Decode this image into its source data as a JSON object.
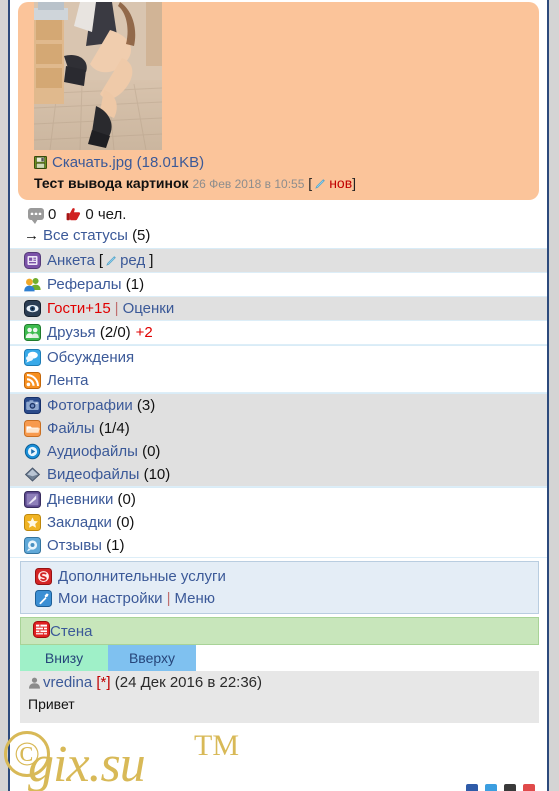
{
  "status_card": {
    "photo_alt": "status-photo",
    "file": {
      "icon": "floppy-disk-icon",
      "name": "Скачать.jpg",
      "size": "(18.01KB)"
    },
    "title": "Тест вывода картинок",
    "date": "26 Фев 2018 в 10:55",
    "edit_open": "[",
    "edit_label": "нов",
    "edit_close": "]"
  },
  "counters": {
    "comments_icon": "comment-bubble-icon",
    "comments": "0",
    "likes_icon": "thumbs-up-icon",
    "likes": "0 чел.",
    "all_statuses_arrow": "→",
    "all_statuses_label": "Все статусы",
    "all_statuses_count": "(5)"
  },
  "menu": {
    "group1": [
      {
        "icon": "profile-card-icon",
        "label": "Анкета",
        "open": "[",
        "action": "ред",
        "close": "]",
        "shaded": true
      },
      {
        "icon": "referrals-people-icon",
        "label": "Рефералы",
        "count": "(1)",
        "shaded": false
      },
      {
        "icon": "eye-icon",
        "label": "Гости",
        "plus": "+15",
        "sep": "|",
        "label2": "Оценки",
        "shaded": true
      },
      {
        "icon": "friends-icon",
        "label": "Друзья",
        "count": "(2/0)",
        "plus": "+2",
        "shaded": false
      }
    ],
    "group2": [
      {
        "icon": "discussions-icon",
        "label": "Обсуждения"
      },
      {
        "icon": "rss-feed-icon",
        "label": "Лента"
      }
    ],
    "group3": [
      {
        "icon": "photos-camera-icon",
        "label": "Фотографии",
        "count": "(3)"
      },
      {
        "icon": "files-folder-icon",
        "label": "Файлы",
        "count": "(1/4)"
      },
      {
        "icon": "audio-play-icon",
        "label": "Аудиофайлы",
        "count": "(0)"
      },
      {
        "icon": "video-diamond-icon",
        "label": "Видеофайлы",
        "count": "(10)"
      }
    ],
    "group4": [
      {
        "icon": "diary-icon",
        "label": "Дневники",
        "count": "(0)"
      },
      {
        "icon": "bookmark-star-icon",
        "label": "Закладки",
        "count": "(0)"
      },
      {
        "icon": "reviews-icon",
        "label": "Отзывы",
        "count": "(1)"
      }
    ]
  },
  "services": {
    "extra_icon": "extra-services-icon",
    "extra_label": "Дополнительные услуги",
    "settings_icon": "wrench-settings-icon",
    "settings_label": "Мои настройки",
    "separator": "|",
    "menu_label": "Меню"
  },
  "wall": {
    "icon": "wall-brick-icon",
    "title": "Стена",
    "tabs": [
      {
        "label": "Внизу",
        "active": false
      },
      {
        "label": "Вверху",
        "active": true
      }
    ],
    "comment": {
      "avatar_icon": "user-avatar-icon",
      "author": "vredina",
      "star": "[*]",
      "date": "(24 Дек 2016 в 22:36)",
      "text": "Привет"
    }
  },
  "watermark": {
    "copyright": "©",
    "text": "gix.su",
    "tm": "TM"
  },
  "colors": {
    "card_bg": "#fbc49a",
    "link": "#3b5998",
    "alert": "#e00000",
    "wall_header": "#c8e6bb",
    "tab_active": "#7fc1f0",
    "tab_inactive": "#9ff0c8",
    "frame_border": "#2c4a7c"
  }
}
